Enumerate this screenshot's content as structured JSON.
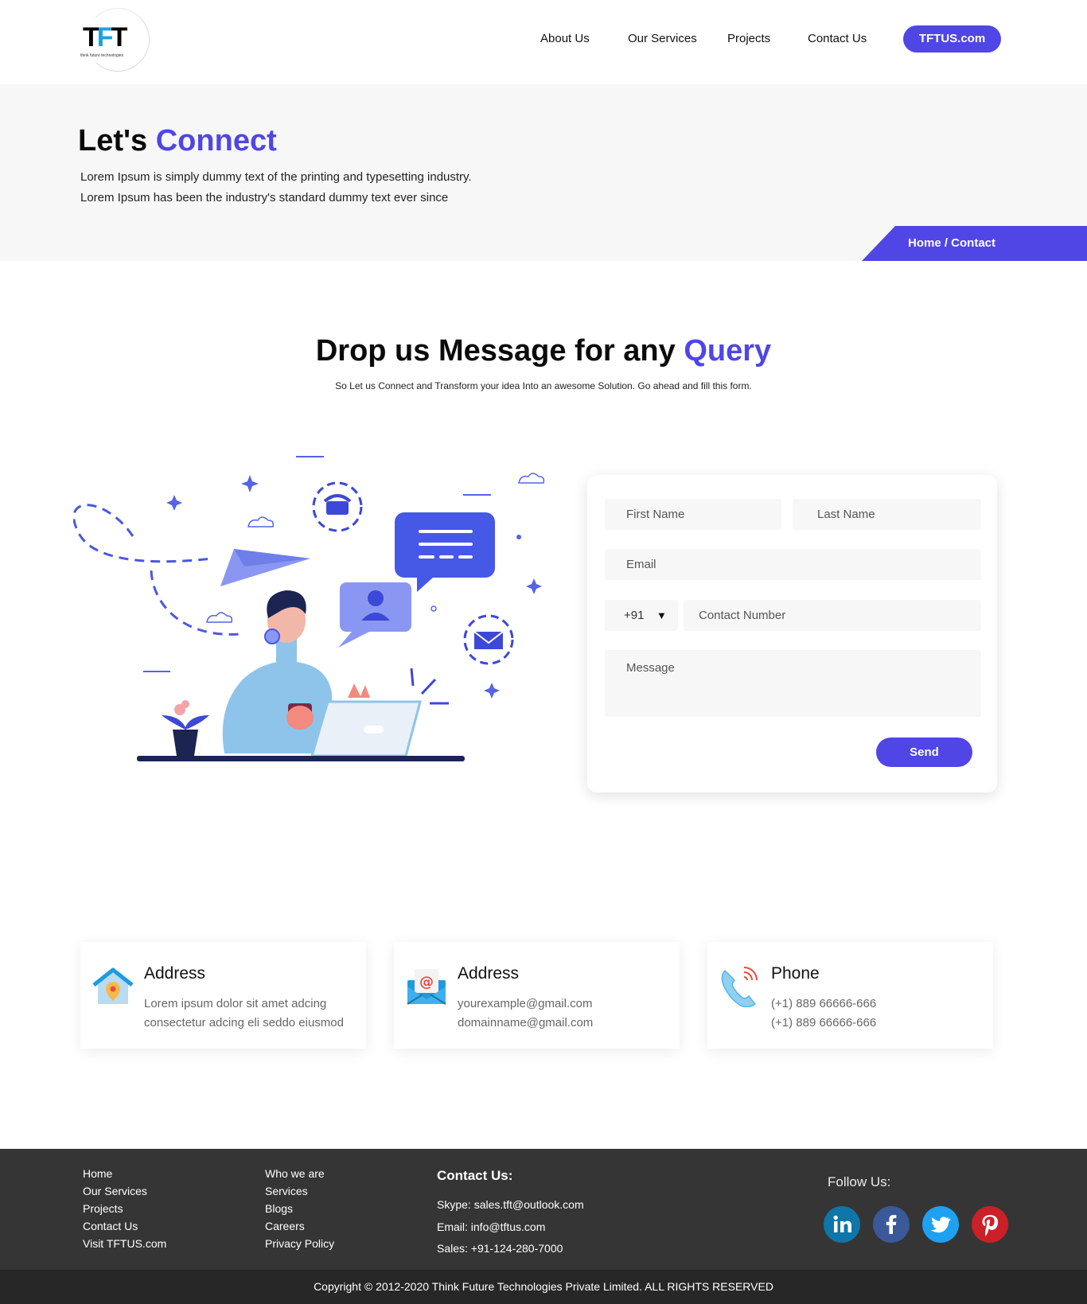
{
  "nav": {
    "logo_text": "TFT",
    "logo_sub": "think future technologies",
    "links": [
      "About Us",
      "Our Services",
      "Projects",
      "Contact Us"
    ],
    "cta": "TFTUS.com"
  },
  "hero": {
    "title_prefix": "Let's ",
    "title_accent": "Connect",
    "desc_line1": "Lorem Ipsum is simply dummy text of the printing and typesetting industry.",
    "desc_line2": "Lorem Ipsum has been the industry's standard dummy text ever since",
    "breadcrumb": "Home / Contact"
  },
  "section": {
    "title_prefix": "Drop us Message for any ",
    "title_accent": "Query",
    "subtitle": "So Let us Connect and Transform your idea Into an awesome Solution. Go ahead and fill this form."
  },
  "form": {
    "first_name_placeholder": "First Name",
    "last_name_placeholder": "Last Name",
    "email_placeholder": "Email",
    "country_code": "+91",
    "phone_placeholder": "Contact Number",
    "message_placeholder": "Message",
    "send_label": "Send"
  },
  "info_cards": [
    {
      "icon": "house-location-icon",
      "title": "Address",
      "line1": "Lorem ipsum dolor sit amet adcing",
      "line2": "consectetur adcing eli seddo eiusmod"
    },
    {
      "icon": "mail-envelope-icon",
      "title": "Address",
      "line1": "yourexample@gmail.com",
      "line2": "domainname@gmail.com"
    },
    {
      "icon": "phone-icon",
      "title": "Phone",
      "line1": "(+1) 889 66666-666",
      "line2": "(+1) 889 66666-666"
    }
  ],
  "footer": {
    "col1": [
      "Home",
      "Our Services",
      "Projects",
      "Contact Us",
      "Visit TFTUS.com"
    ],
    "col2": [
      "Who we are",
      "Services",
      "Blogs",
      "Careers",
      "Privacy Policy"
    ],
    "contact_title": "Contact Us:",
    "skype": "Skype: sales.tft@outlook.com",
    "email": "Email: info@tftus.com",
    "sales": "Sales: +91-124-280-7000",
    "follow_title": "Follow Us:",
    "socials": [
      {
        "name": "linkedin-icon",
        "color": "#0e76a8"
      },
      {
        "name": "facebook-icon",
        "color": "#3b5998"
      },
      {
        "name": "twitter-icon",
        "color": "#1da1f2"
      },
      {
        "name": "pinterest-icon",
        "color": "#cb2027"
      }
    ],
    "copyright": "Copyright © 2012-2020 Think Future Technologies Private Limited. ALL RIGHTS RESERVED"
  },
  "colors": {
    "accent": "#4f46e5",
    "footer_bg": "#353535",
    "copyright_bg": "#272727",
    "hero_bg": "#f7f7f7"
  }
}
